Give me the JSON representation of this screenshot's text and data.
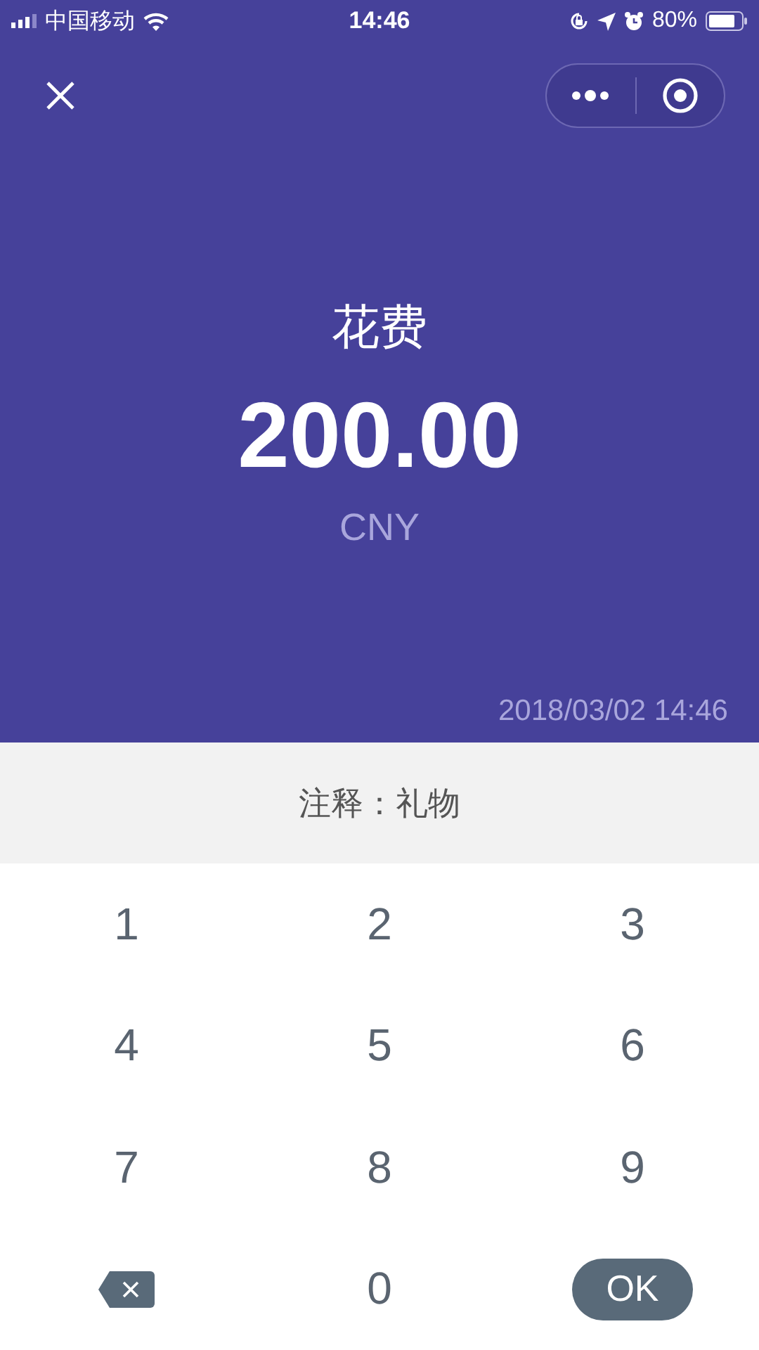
{
  "status_bar": {
    "carrier": "中国移动",
    "time": "14:46",
    "battery": "80%"
  },
  "header": {
    "category": "花费",
    "amount": "200.00",
    "currency": "CNY",
    "datetime": "2018/03/02 14:46"
  },
  "note": "注释：礼物",
  "keypad": [
    {
      "kind": "digit",
      "label": "1"
    },
    {
      "kind": "digit",
      "label": "2"
    },
    {
      "kind": "digit",
      "label": "3"
    },
    {
      "kind": "digit",
      "label": "4"
    },
    {
      "kind": "digit",
      "label": "5"
    },
    {
      "kind": "digit",
      "label": "6"
    },
    {
      "kind": "digit",
      "label": "7"
    },
    {
      "kind": "digit",
      "label": "8"
    },
    {
      "kind": "digit",
      "label": "9"
    },
    {
      "kind": "delete"
    },
    {
      "kind": "digit",
      "label": "0"
    },
    {
      "kind": "ok",
      "label": "OK"
    }
  ]
}
